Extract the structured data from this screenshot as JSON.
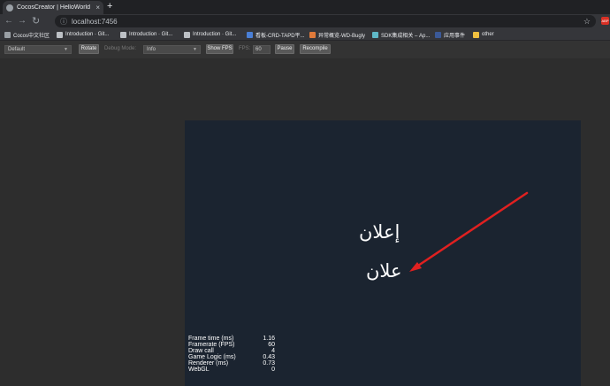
{
  "tab": {
    "title": "CocosCreator | HelloWorld",
    "close": "×",
    "new_tab": "+"
  },
  "toolbar": {
    "back": "←",
    "forward": "→",
    "reload": "↻",
    "info": "ⓘ",
    "url": "localhost:7456",
    "star": "☆",
    "extension": "ABP"
  },
  "bookmarks": [
    {
      "label": "Cocos中文社区",
      "color": "#9aa0a6"
    },
    {
      "label": "Introduction · Git...",
      "color": "#bdc1c6"
    },
    {
      "label": "Introduction · Git...",
      "color": "#bdc1c6"
    },
    {
      "label": "Introduction · Git...",
      "color": "#bdc1c6"
    },
    {
      "label": "看板-CRD-TAPD平...",
      "color": "#4a7fd6"
    },
    {
      "label": "异常概览-WD-Bugly",
      "color": "#e07a3a"
    },
    {
      "label": "SDK集成相关 – Ap...",
      "color": "#5fb8c7"
    },
    {
      "label": "应用事件",
      "color": "#3b5998"
    },
    {
      "label": "other",
      "color": "#f0c040"
    }
  ],
  "devbar": {
    "device_select": "Default",
    "rotate": "Rotate",
    "debug_mode_label": "Debug Mode:",
    "debug_mode_value": "Info",
    "show_fps": "Show FPS",
    "fps_label": "FPS:",
    "fps_value": "60",
    "pause": "Pause",
    "recompile": "Recompile"
  },
  "game": {
    "label_top": "إعلان",
    "label_bottom": "علان",
    "arrow_color": "#e02020",
    "stats": [
      {
        "name": "Frame time (ms)",
        "value": "1.16"
      },
      {
        "name": "Framerate (FPS)",
        "value": "60"
      },
      {
        "name": "Draw call",
        "value": "4"
      },
      {
        "name": "Game Logic (ms)",
        "value": "0.43"
      },
      {
        "name": "Renderer (ms)",
        "value": "0.73"
      },
      {
        "name": "WebGL",
        "value": "0"
      }
    ]
  }
}
